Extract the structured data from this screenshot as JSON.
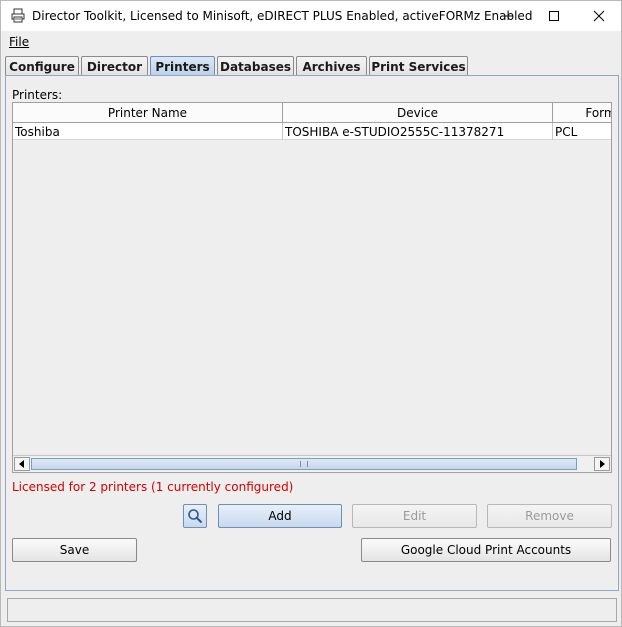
{
  "window": {
    "title": "Director Toolkit, Licensed to Minisoft, eDIRECT PLUS Enabled, activeFORMz Enabled"
  },
  "menu": {
    "file": "File"
  },
  "tabs": [
    {
      "label": "Configure"
    },
    {
      "label": "Director"
    },
    {
      "label": "Printers",
      "active": true
    },
    {
      "label": "Databases"
    },
    {
      "label": "Archives"
    },
    {
      "label": "Print Services"
    }
  ],
  "printers": {
    "label": "Printers:",
    "columns": [
      "Printer Name",
      "Device",
      "Format"
    ],
    "rows": [
      [
        "Toshiba",
        "TOSHIBA e-STUDIO2555C-11378271",
        "PCL"
      ]
    ],
    "license_text": "Licensed for 2 printers (1 currently configured)"
  },
  "buttons": {
    "add": "Add",
    "edit": "Edit",
    "remove": "Remove",
    "save": "Save",
    "google_cloud": "Google Cloud Print Accounts"
  },
  "colors": {
    "license_text": "#d60000",
    "accent": "#6f8fb3"
  },
  "icons": {
    "app": "printer-icon",
    "search": "search-icon",
    "minimize": "minimize-icon",
    "maximize": "maximize-icon",
    "close": "close-icon"
  }
}
